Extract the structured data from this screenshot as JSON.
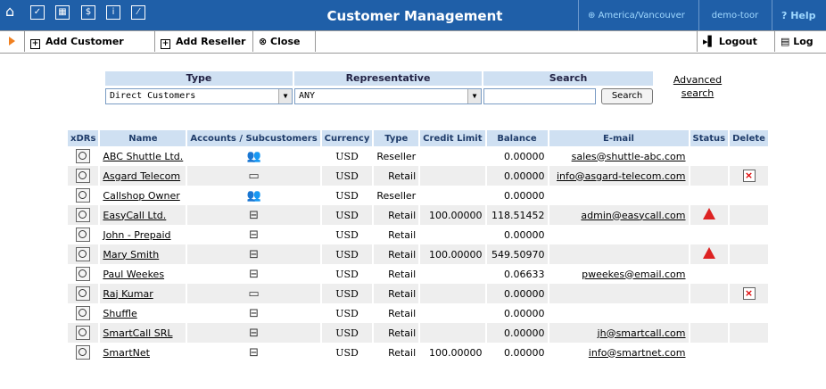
{
  "header": {
    "title": "Customer Management",
    "timezone": "America/Vancouver",
    "user": "demo-toor",
    "help": "Help"
  },
  "toolbar": {
    "add_customer": "Add Customer",
    "add_reseller": "Add Reseller",
    "close": "Close",
    "logout": "Logout",
    "log": "Log"
  },
  "filters": {
    "type_label": "Type",
    "type_value": "Direct Customers",
    "rep_label": "Representative",
    "rep_value": "ANY",
    "search_label": "Search",
    "search_value": "",
    "search_button": "Search",
    "advanced": "Advanced search"
  },
  "table": {
    "columns": [
      "xDRs",
      "Name",
      "Accounts / Subcustomers",
      "Currency",
      "Type",
      "Credit Limit",
      "Balance",
      "E-mail",
      "Status",
      "Delete"
    ],
    "rows": [
      {
        "name": "ABC Shuttle Ltd.",
        "currency": "USD",
        "type": "Reseller",
        "credit": "",
        "balance": "0.00000",
        "email": "sales@shuttle-abc.com",
        "status": "",
        "delete": ""
      },
      {
        "name": "Asgard Telecom",
        "currency": "USD",
        "type": "Retail",
        "credit": "",
        "balance": "0.00000",
        "email": "info@asgard-telecom.com",
        "status": "",
        "delete": "x"
      },
      {
        "name": "Callshop Owner",
        "currency": "USD",
        "type": "Reseller",
        "credit": "",
        "balance": "0.00000",
        "email": "",
        "status": "",
        "delete": ""
      },
      {
        "name": "EasyCall Ltd.",
        "currency": "USD",
        "type": "Retail",
        "credit": "100.00000",
        "balance": "118.51452",
        "email": "admin@easycall.com",
        "status": "warn",
        "delete": ""
      },
      {
        "name": "John - Prepaid",
        "currency": "USD",
        "type": "Retail",
        "credit": "",
        "balance": "0.00000",
        "email": "",
        "status": "",
        "delete": ""
      },
      {
        "name": "Mary Smith",
        "currency": "USD",
        "type": "Retail",
        "credit": "100.00000",
        "balance": "549.50970",
        "email": "",
        "status": "warn",
        "delete": ""
      },
      {
        "name": "Paul Weekes",
        "currency": "USD",
        "type": "Retail",
        "credit": "",
        "balance": "0.06633",
        "email": "pweekes@email.com",
        "status": "",
        "delete": ""
      },
      {
        "name": "Raj Kumar",
        "currency": "USD",
        "type": "Retail",
        "credit": "",
        "balance": "0.00000",
        "email": "",
        "status": "",
        "delete": "x"
      },
      {
        "name": "Shuffle",
        "currency": "USD",
        "type": "Retail",
        "credit": "",
        "balance": "0.00000",
        "email": "",
        "status": "",
        "delete": ""
      },
      {
        "name": "SmartCall SRL",
        "currency": "USD",
        "type": "Retail",
        "credit": "",
        "balance": "0.00000",
        "email": "jh@smartcall.com",
        "status": "",
        "delete": ""
      },
      {
        "name": "SmartNet",
        "currency": "USD",
        "type": "Retail",
        "credit": "100.00000",
        "balance": "0.00000",
        "email": "info@smartnet.com",
        "status": "",
        "delete": ""
      }
    ]
  }
}
